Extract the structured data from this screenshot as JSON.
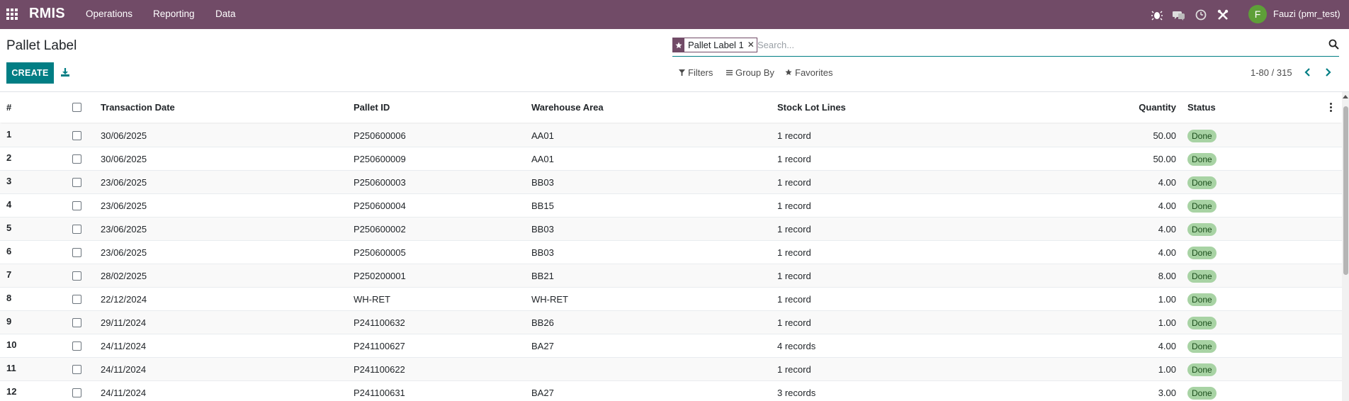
{
  "navbar": {
    "brand": "RMIS",
    "menus": [
      "Operations",
      "Reporting",
      "Data"
    ],
    "user_initial": "F",
    "user_name": "Fauzi (pmr_test)",
    "background_color": "#714B67",
    "icons": [
      "apps-grid-icon",
      "bug-icon",
      "chat-icon",
      "clock-icon",
      "tools-icon"
    ]
  },
  "control_panel": {
    "title": "Pallet Label",
    "create_label": "CREATE",
    "search": {
      "facet_label": "Pallet Label 1",
      "placeholder": "Search..."
    },
    "filters_label": "Filters",
    "group_by_label": "Group By",
    "favorites_label": "Favorites",
    "pager": "1-80 / 315"
  },
  "table": {
    "columns": {
      "number": "#",
      "transaction_date": "Transaction Date",
      "pallet_id": "Pallet ID",
      "warehouse_area": "Warehouse Area",
      "stock_lot_lines": "Stock Lot Lines",
      "quantity": "Quantity",
      "status": "Status"
    },
    "rows": [
      {
        "no": "1",
        "date": "30/06/2025",
        "pallet": "P250600006",
        "area": "AA01",
        "lines": "1 record",
        "qty": "50.00",
        "status": "Done"
      },
      {
        "no": "2",
        "date": "30/06/2025",
        "pallet": "P250600009",
        "area": "AA01",
        "lines": "1 record",
        "qty": "50.00",
        "status": "Done"
      },
      {
        "no": "3",
        "date": "23/06/2025",
        "pallet": "P250600003",
        "area": "BB03",
        "lines": "1 record",
        "qty": "4.00",
        "status": "Done"
      },
      {
        "no": "4",
        "date": "23/06/2025",
        "pallet": "P250600004",
        "area": "BB15",
        "lines": "1 record",
        "qty": "4.00",
        "status": "Done"
      },
      {
        "no": "5",
        "date": "23/06/2025",
        "pallet": "P250600002",
        "area": "BB03",
        "lines": "1 record",
        "qty": "4.00",
        "status": "Done"
      },
      {
        "no": "6",
        "date": "23/06/2025",
        "pallet": "P250600005",
        "area": "BB03",
        "lines": "1 record",
        "qty": "4.00",
        "status": "Done"
      },
      {
        "no": "7",
        "date": "28/02/2025",
        "pallet": "P250200001",
        "area": "BB21",
        "lines": "1 record",
        "qty": "8.00",
        "status": "Done"
      },
      {
        "no": "8",
        "date": "22/12/2024",
        "pallet": "WH-RET",
        "area": "WH-RET",
        "lines": "1 record",
        "qty": "1.00",
        "status": "Done"
      },
      {
        "no": "9",
        "date": "29/11/2024",
        "pallet": "P241100632",
        "area": "BB26",
        "lines": "1 record",
        "qty": "1.00",
        "status": "Done"
      },
      {
        "no": "10",
        "date": "24/11/2024",
        "pallet": "P241100627",
        "area": "BA27",
        "lines": "4 records",
        "qty": "4.00",
        "status": "Done"
      },
      {
        "no": "11",
        "date": "24/11/2024",
        "pallet": "P241100622",
        "area": "",
        "lines": "1 record",
        "qty": "1.00",
        "status": "Done"
      },
      {
        "no": "12",
        "date": "24/11/2024",
        "pallet": "P241100631",
        "area": "BA27",
        "lines": "3 records",
        "qty": "3.00",
        "status": "Done"
      }
    ]
  },
  "colors": {
    "accent": "#017e84",
    "brand": "#714B67",
    "status_done": "#a8d3a4"
  }
}
